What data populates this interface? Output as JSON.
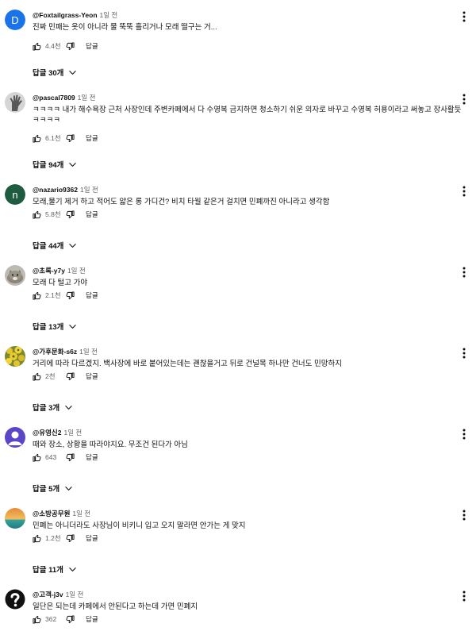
{
  "reply_label": "답글",
  "comments": [
    {
      "author": "@Foxtailgrass-Yeon",
      "time": "1일 전",
      "text": "진짜 민패는 옷이 아니라 물 뚝뚝 흘리거나 모래 떨구는 거...",
      "likes": "4.4천",
      "replies": "답글 30개",
      "avatar": {
        "type": "letter",
        "letter": "D",
        "color": "#1a73e8"
      }
    },
    {
      "author": "@pascal7809",
      "time": "1일 전",
      "text": "ㅋㅋㅋㅋ 내가 해수욕장 근처 사장인데 주변카페에서 다 수영복 금지하면 청소하기 쉬운 의자로 바꾸고 수영복 허용이라고 써놓고 장사활듯 ㅋㅋㅋㅋ",
      "likes": "6.1천",
      "replies": "답글 94개",
      "avatar": {
        "type": "image",
        "description": "gray-hand-photo"
      }
    },
    {
      "author": "@nazario9362",
      "time": "1일 전",
      "text": "모래,물기 제거 하고 적어도 얇은 롱 가디건? 비치 타월 같은거 걸치면 민폐까진 아니라고 생각함",
      "likes": "5.8천",
      "replies": "답글 44개",
      "avatar": {
        "type": "letter",
        "letter": "n",
        "color": "#1e5b3f"
      }
    },
    {
      "author": "@초록-y7y",
      "time": "1일 전",
      "text": "모래 다 털고 가야",
      "likes": "2.1천",
      "replies": "답글 13개",
      "avatar": {
        "type": "image",
        "description": "cat-photo"
      }
    },
    {
      "author": "@가후문화-s6z",
      "time": "1일 전",
      "text": "거리에 따라 다르겠지. 백사장에 바로 붙어있는데는 괜찮을거고 뒤로 건널목 하나만 건너도 민망하지",
      "likes": "2천",
      "replies": "답글 3개",
      "avatar": {
        "type": "image",
        "description": "yellow-flowers-photo"
      }
    },
    {
      "author": "@유영신2",
      "time": "1일 전",
      "text": "때와 장소, 상황을 따라야지요.  무조건 된다가  아님",
      "likes": "643",
      "replies": "답글 5개",
      "avatar": {
        "type": "image",
        "description": "purple-default-person"
      }
    },
    {
      "author": "@소방공무원",
      "time": "1일 전",
      "text": "민폐는 아니더라도 사장님이 비키니 입고 오지 말라면 안가는 게 맞지",
      "likes": "1.2천",
      "replies": "답글 11개",
      "avatar": {
        "type": "image",
        "description": "sunset-sea-photo"
      }
    },
    {
      "author": "@고객-j3v",
      "time": "1일 전",
      "text": "일단은 되는데 카페에서 안된다고 하는데 가면 민폐지",
      "likes": "362",
      "replies": "",
      "avatar": {
        "type": "image",
        "description": "black-question-mark"
      }
    }
  ]
}
